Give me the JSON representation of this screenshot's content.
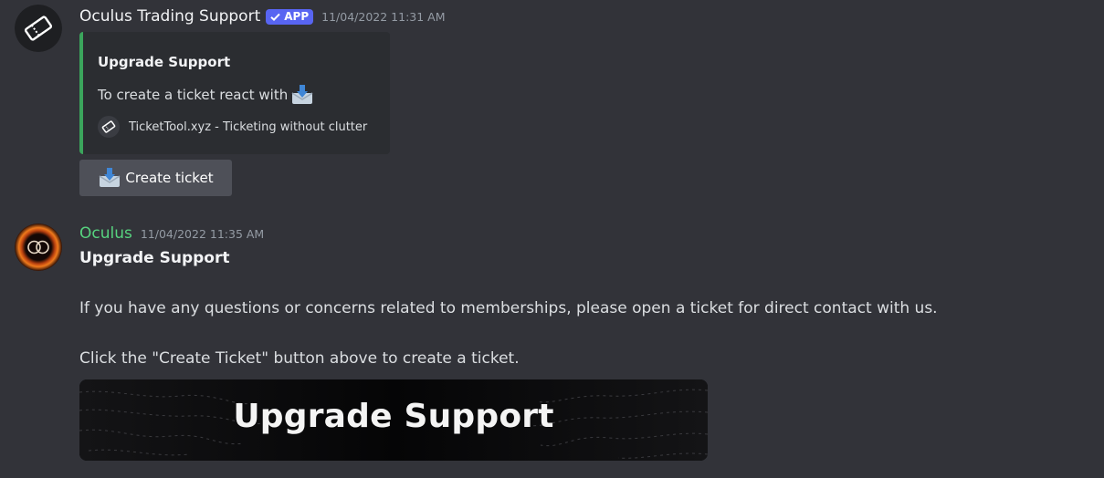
{
  "message1": {
    "username": "Oculus Trading Support",
    "badge": "APP",
    "timestamp": "11/04/2022 11:31 AM",
    "embed": {
      "title": "Upgrade Support",
      "description": "To create a ticket react with",
      "description_icon": "inbox-tray-icon",
      "footer_text": "TicketTool.xyz - Ticketing without clutter",
      "footer_icon": "ticket-icon",
      "accent_color": "#3ba55c"
    },
    "button": {
      "label": "Create ticket",
      "icon": "inbox-tray-icon"
    }
  },
  "message2": {
    "username": "Oculus",
    "username_color": "#57d37f",
    "timestamp": "11/04/2022 11:35 AM",
    "bold_line": "Upgrade Support",
    "line1": "If you have any questions or concerns related to memberships, please open a ticket for direct contact with us.",
    "line2": "Click the \"Create Ticket\" button above to create a ticket.",
    "banner_text": "Upgrade Support"
  }
}
